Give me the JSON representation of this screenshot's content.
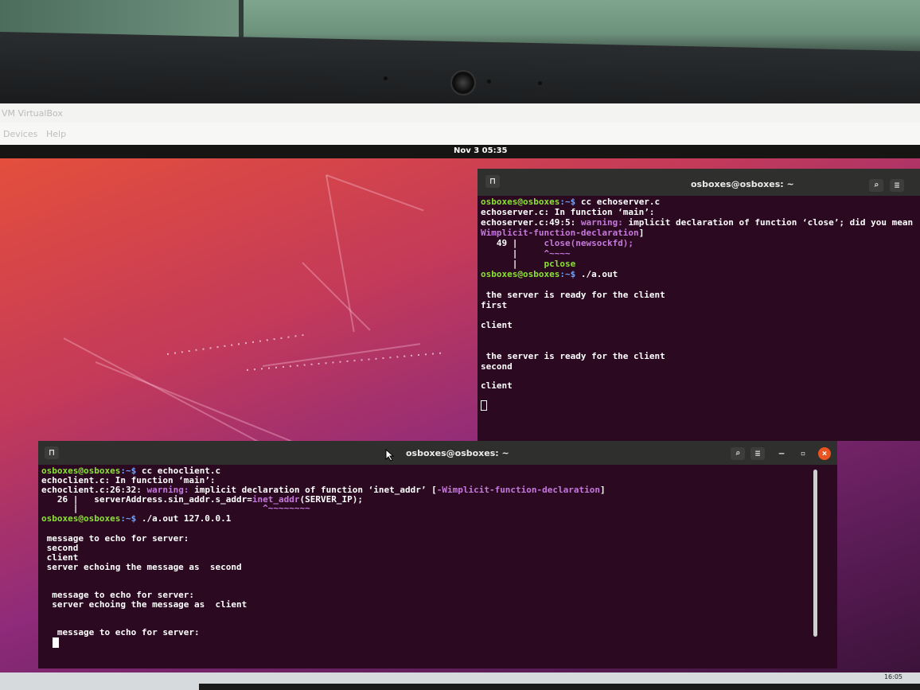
{
  "virtualbox": {
    "title": "VM VirtualBox",
    "menu": [
      "Devices",
      "Help"
    ]
  },
  "topbar": {
    "clock": "Nov 3  05:35"
  },
  "server_terminal": {
    "title": "osboxes@osboxes: ~",
    "new_tab_icon": "terminal-icon",
    "search_icon": "search-icon",
    "menu_icon": "hamburger-icon",
    "prompt": "osboxes@osboxes",
    "prompt_path": ":~$",
    "lines": {
      "cmd1": " cc echoserver.c",
      "err1": "echoserver.c: In function ‘main’:",
      "warn_loc": "echoserver.c:49:5:",
      "warn_label": " warning:",
      "warn_msg": " implicit declaration of function ‘close’; did you mean ‘pc",
      "warn_flag": "Wimplicit-function-declaration",
      "warn_flag_close": "]",
      "src_num": "   49 |",
      "src_code": "     close(newsockfd);",
      "src_bar1": "      |",
      "src_caret": "     ^~~~~",
      "src_bar2": "      |",
      "src_hint": "     pclose",
      "cmd2": " ./a.out",
      "out1": " the server is ready for the client",
      "out2": "first",
      "out3": "client",
      "out4": " the server is ready for the client",
      "out5": "second",
      "out6": "client"
    }
  },
  "client_terminal": {
    "title": "osboxes@osboxes: ~",
    "minimize_label": "–",
    "maximize_label": "▫",
    "close_label": "×",
    "prompt": "osboxes@osboxes",
    "prompt_path": ":~$",
    "lines": {
      "cmd1": " cc echoclient.c",
      "err1": "echoclient.c: In function ‘main’:",
      "warn_loc": "echoclient.c:26:32:",
      "warn_label": " warning:",
      "warn_msg": " implicit declaration of function ‘inet_addr’ [",
      "warn_flag": "-Wimplicit-function-declaration",
      "warn_flag_close": "]",
      "src_num": "   26 |",
      "src_code_a": "   serverAddress.sin_addr.s_addr=",
      "src_code_b": "inet_addr",
      "src_code_c": "(SERVER_IP);",
      "src_caret": "                                   ^~~~~~~~~",
      "src_bar": "      |",
      "cmd2": " ./a.out 127.0.0.1",
      "o1": " message to echo for server:",
      "o2": " second",
      "o3": " client",
      "o4": " server echoing the message as  second",
      "o5": "  message to echo for server:",
      "o6": "  server echoing the message as  client",
      "o7": "   message to echo for server:"
    }
  },
  "taskbar": {
    "time": "16:05"
  }
}
